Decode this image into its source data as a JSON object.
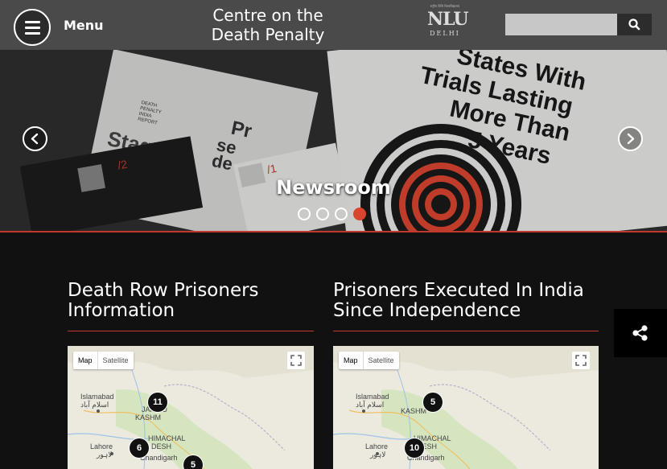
{
  "header": {
    "menu_label": "Menu",
    "title_line1": "Centre on the",
    "title_line2": "Death Penalty",
    "logo_tagline": "राष्ट्रीय विधि विश्वविद्यालय",
    "logo_text": "NLU",
    "logo_city": "DELHI",
    "search_placeholder": "",
    "icons": {
      "menu": "hamburger-icon",
      "search": "magnifier-icon"
    }
  },
  "hero": {
    "caption": "Newsroom",
    "slide_count": 4,
    "active_slide": 4,
    "poster_text": [
      "States With",
      "Trials Lasting",
      "More Than",
      "5 Years"
    ],
    "report_text": [
      "DEATH",
      "PENALTY",
      "INDIA",
      "REPORT"
    ],
    "report_words": [
      "Stages",
      "Pr",
      "se",
      "de"
    ],
    "accent": "#d9452f"
  },
  "sections": [
    {
      "title_line1": "Death Row Prisoners",
      "title_line2": "Information",
      "map": {
        "type_map": "Map",
        "type_satellite": "Satellite",
        "labels": [
          "Islamabad",
          "اسلام آباد",
          "JAMMU",
          "KASHM",
          "HIMACHAL",
          "DESH",
          "Lahore",
          "لاہور",
          "Chandigarh"
        ],
        "markers": [
          "11",
          "6",
          "5"
        ]
      }
    },
    {
      "title_line1": "Prisoners Executed In India",
      "title_line2": "Since Independence",
      "map": {
        "type_map": "Map",
        "type_satellite": "Satellite",
        "labels": [
          "Islamabad",
          "اسلام آباد",
          "KASHM",
          "HIMACHAL",
          "DESH",
          "Lahore",
          "لاہور",
          "Chandigarh"
        ],
        "markers": [
          "5",
          "10"
        ]
      }
    }
  ],
  "share": {
    "icon": "share-icon"
  }
}
